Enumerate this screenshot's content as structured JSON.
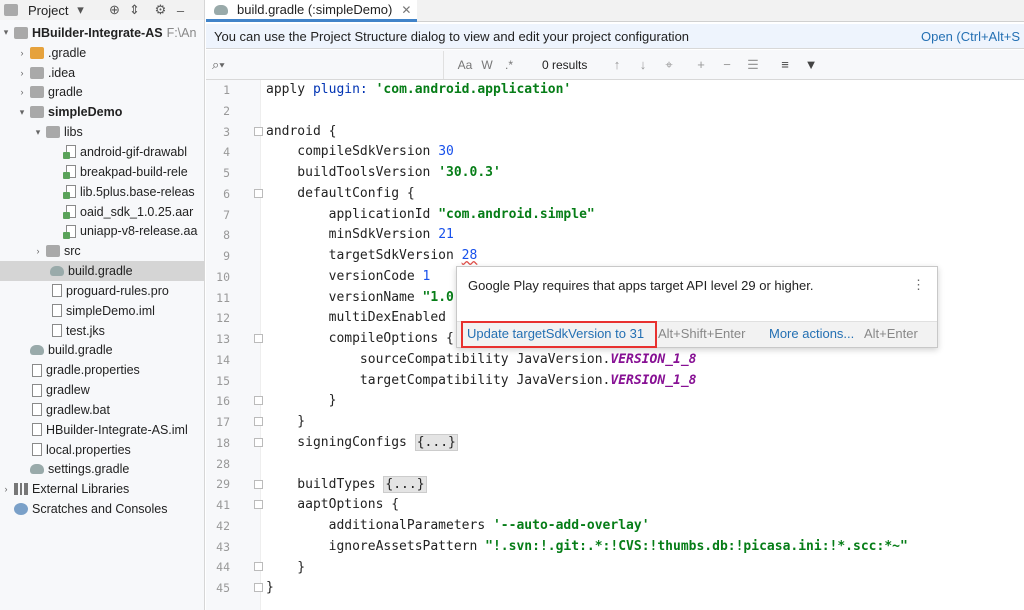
{
  "project_panel": {
    "title": "Project",
    "items": [
      {
        "label": "HBuilder-Integrate-AS",
        "suffix": "F:\\An"
      },
      {
        "label": ".gradle"
      },
      {
        "label": ".idea"
      },
      {
        "label": "gradle"
      },
      {
        "label": "simpleDemo"
      },
      {
        "label": "libs"
      },
      {
        "label": "android-gif-drawabl"
      },
      {
        "label": "breakpad-build-rele"
      },
      {
        "label": "lib.5plus.base-releas"
      },
      {
        "label": "oaid_sdk_1.0.25.aar"
      },
      {
        "label": "uniapp-v8-release.aa"
      },
      {
        "label": "src"
      },
      {
        "label": "build.gradle"
      },
      {
        "label": "proguard-rules.pro"
      },
      {
        "label": "simpleDemo.iml"
      },
      {
        "label": "test.jks"
      },
      {
        "label": "build.gradle"
      },
      {
        "label": "gradle.properties"
      },
      {
        "label": "gradlew"
      },
      {
        "label": "gradlew.bat"
      },
      {
        "label": "HBuilder-Integrate-AS.iml"
      },
      {
        "label": "local.properties"
      },
      {
        "label": "settings.gradle"
      },
      {
        "label": "External Libraries"
      },
      {
        "label": "Scratches and Consoles"
      }
    ]
  },
  "editor": {
    "tab_label": "build.gradle (:simpleDemo)",
    "banner_text": "You can use the Project Structure dialog to view and edit your project configuration",
    "banner_link": "Open (Ctrl+Alt+S",
    "search": {
      "case_opt": "Aa",
      "word_opt": "W",
      "regex_opt": ".*",
      "results": "0 results"
    },
    "line_numbers": [
      "1",
      "2",
      "3",
      "4",
      "5",
      "6",
      "7",
      "8",
      "9",
      "10",
      "11",
      "12",
      "13",
      "14",
      "15",
      "16",
      "17",
      "18",
      "28",
      "29",
      "41",
      "42",
      "43",
      "44",
      "45"
    ],
    "code": {
      "l1_a": "apply ",
      "l1_b": "plugin: ",
      "l1_c": "'com.android.application'",
      "l3": "android {",
      "l4_a": "    compileSdkVersion ",
      "l4_b": "30",
      "l5_a": "    buildToolsVersion ",
      "l5_b": "'30.0.3'",
      "l6": "    defaultConfig {",
      "l7_a": "        applicationId ",
      "l7_b": "\"com.android.simple\"",
      "l8_a": "        minSdkVersion ",
      "l8_b": "21",
      "l9_a": "        targetSdkVersion ",
      "l9_b": "28",
      "l10_a": "        versionCode ",
      "l10_b": "1",
      "l11_a": "        versionName ",
      "l11_b": "\"1.0",
      "l12": "        multiDexEnabled",
      "l13": "        compileOptions {",
      "l14_a": "            sourceCompatibility JavaVersion.",
      "l14_b": "VERSION_1_8",
      "l15_a": "            targetCompatibility JavaVersion.",
      "l15_b": "VERSION_1_8",
      "l16": "        }",
      "l17": "    }",
      "l18_a": "    signingConfigs ",
      "l18_b": "{...}",
      "l29_a": "    buildTypes ",
      "l29_b": "{...}",
      "l41": "    aaptOptions {",
      "l42_a": "        additionalParameters ",
      "l42_b": "'--auto-add-overlay'",
      "l43_a": "        ignoreAssetsPattern ",
      "l43_b": "\"!.svn:!.git:.*:!CVS:!thumbs.db:!picasa.ini:!*.scc:*~\"",
      "l44": "    }",
      "l45": "}"
    }
  },
  "popup": {
    "message": "Google Play requires that apps target API level 29 or higher.",
    "action": "Update targetSdkVersion to 31",
    "action_shortcut": "Alt+Shift+Enter",
    "more": "More actions...",
    "more_shortcut": "Alt+Enter"
  }
}
